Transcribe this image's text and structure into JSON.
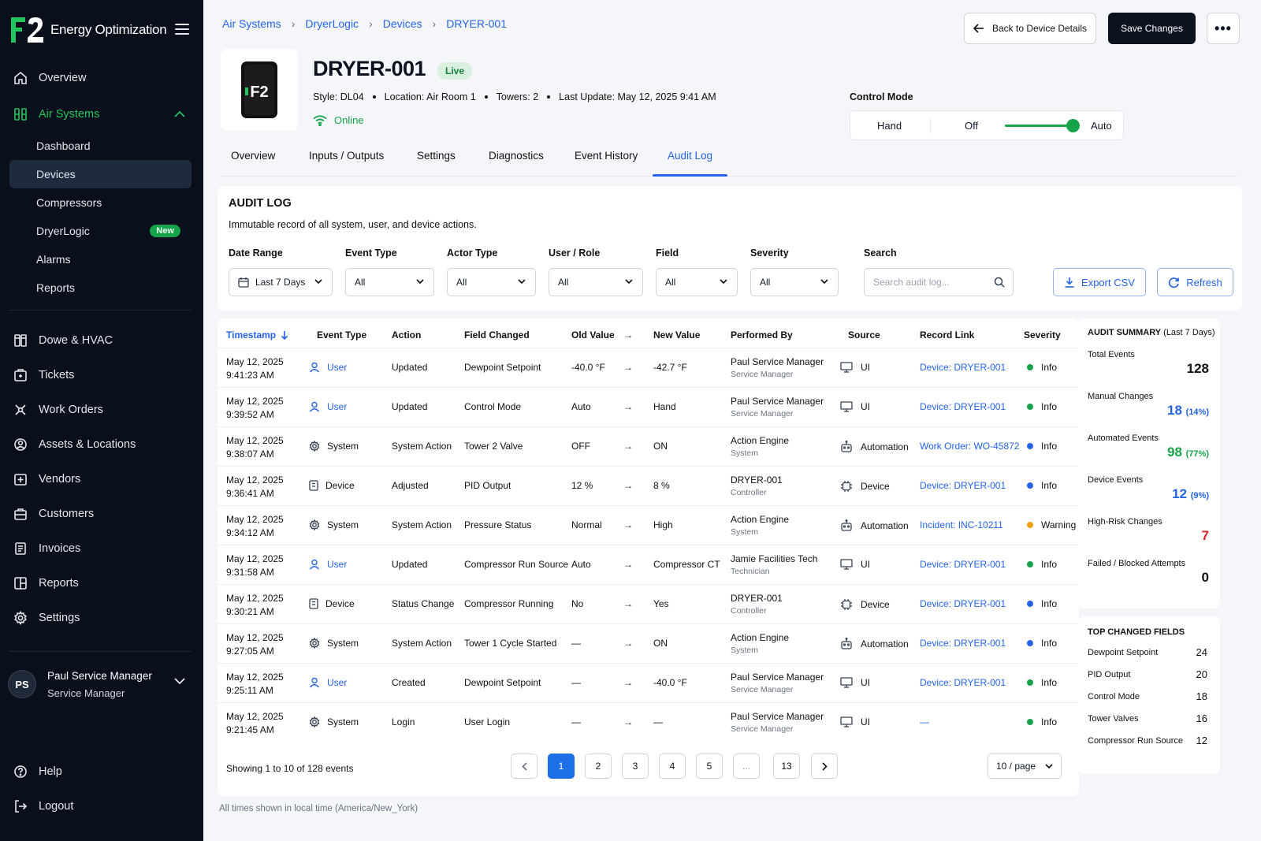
{
  "app": {
    "logo_text": "F2",
    "title": "Energy Optimization"
  },
  "sidebar": {
    "overview": "Overview",
    "air_systems": "Air Systems",
    "sub_items": [
      "Dashboard",
      "Devices",
      "Compressors",
      "DryerLogic",
      "Alarms",
      "Reports"
    ],
    "new_badge": "New",
    "items": [
      "Dowe & HVAC",
      "Tickets",
      "Work Orders",
      "Assets & Locations",
      "Vendors",
      "Customers",
      "Invoices",
      "Reports",
      "Settings"
    ],
    "user": {
      "initials": "PS",
      "name": "Paul Service Manager",
      "role": "Service Manager"
    },
    "help": "Help",
    "logout": "Logout"
  },
  "breadcrumb": [
    "Air Systems",
    "DryerLogic",
    "Devices",
    "DRYER-001"
  ],
  "header": {
    "back_label": "Back to Device Details",
    "save_label": "Save Changes",
    "more_label": "•••"
  },
  "device": {
    "name": "DRYER-001",
    "status_badge": "Live",
    "style": "Style: DL04",
    "location": "Location: Air Room 1",
    "towers": "Towers: 2",
    "last_update": "Last Update: May 12, 2025 9:41 AM",
    "online": "Online",
    "image_text": "F2"
  },
  "control_mode": {
    "label": "Control Mode",
    "hand": "Hand",
    "off": "Off",
    "auto": "Auto",
    "value": 1.0
  },
  "tabs": [
    "Overview",
    "Inputs / Outputs",
    "Settings",
    "Diagnostics",
    "Event History",
    "Audit Log"
  ],
  "audit": {
    "title": "AUDIT LOG",
    "description": "Immutable record of all system, user, and device actions.",
    "filters": {
      "date_range": {
        "label": "Date Range",
        "value": "Last 7 Days"
      },
      "event_type": {
        "label": "Event Type",
        "value": "All"
      },
      "actor_type": {
        "label": "Actor Type",
        "value": "All"
      },
      "user_role": {
        "label": "User / Role",
        "value": "All"
      },
      "field": {
        "label": "Field",
        "value": "All"
      },
      "severity": {
        "label": "Severity",
        "value": "All"
      },
      "search": {
        "label": "Search",
        "placeholder": "Search audit log..."
      }
    },
    "export_label": "Export CSV",
    "refresh_label": "Refresh"
  },
  "table": {
    "columns": [
      "Timestamp",
      "Event Type",
      "Action",
      "Field Changed",
      "Old Value",
      "→",
      "New Value",
      "Performed By",
      "Source",
      "Record Link",
      "Severity"
    ],
    "rows": [
      {
        "date": "May 12, 2025",
        "time": "9:41:23 AM",
        "event_type": "User",
        "action": "Updated",
        "field": "Dewpoint Setpoint",
        "old": "-40.0 °F",
        "arrow": "→",
        "new": "-42.7 °F",
        "by": "Paul Service Manager",
        "by_role": "Service Manager",
        "source": "UI",
        "link": "Device: DRYER-001",
        "severity": "Info",
        "sev_color": "#16a34a"
      },
      {
        "date": "May 12, 2025",
        "time": "9:39:52 AM",
        "event_type": "User",
        "action": "Updated",
        "field": "Control Mode",
        "old": "Auto",
        "arrow": "→",
        "new": "Hand",
        "by": "Paul Service Manager",
        "by_role": "Service Manager",
        "source": "UI",
        "link": "Device: DRYER-001",
        "severity": "Info",
        "sev_color": "#16a34a"
      },
      {
        "date": "May 12, 2025",
        "time": "9:38:07 AM",
        "event_type": "System",
        "action": "System Action",
        "field": "Tower 2 Valve",
        "old": "OFF",
        "arrow": "→",
        "new": "ON",
        "by": "Action Engine",
        "by_role": "System",
        "source": "Automation",
        "link": "Work Order: WO-45872",
        "severity": "Info",
        "sev_color": "#2563eb"
      },
      {
        "date": "May 12, 2025",
        "time": "9:36:41 AM",
        "event_type": "Device",
        "action": "Adjusted",
        "field": "PID Output",
        "old": "12 %",
        "arrow": "→",
        "new": "8 %",
        "by": "DRYER-001",
        "by_role": "Controller",
        "source": "Device",
        "link": "Device: DRYER-001",
        "severity": "Info",
        "sev_color": "#2563eb"
      },
      {
        "date": "May 12, 2025",
        "time": "9:34:12 AM",
        "event_type": "System",
        "action": "System Action",
        "field": "Pressure Status",
        "old": "Normal",
        "arrow": "→",
        "new": "High",
        "by": "Action Engine",
        "by_role": "System",
        "source": "Automation",
        "link": "Incident: INC-10211",
        "severity": "Warning",
        "sev_color": "#f59e0b"
      },
      {
        "date": "May 12, 2025",
        "time": "9:31:58 AM",
        "event_type": "User",
        "action": "Updated",
        "field": "Compressor Run Source",
        "old": "Auto",
        "arrow": "→",
        "new": "Compressor CT",
        "by": "Jamie Facilities Tech",
        "by_role": "Technician",
        "source": "UI",
        "link": "Device: DRYER-001",
        "severity": "Info",
        "sev_color": "#16a34a"
      },
      {
        "date": "May 12, 2025",
        "time": "9:30:21 AM",
        "event_type": "Device",
        "action": "Status Change",
        "field": "Compressor Running",
        "old": "No",
        "arrow": "→",
        "new": "Yes",
        "by": "DRYER-001",
        "by_role": "Controller",
        "source": "Device",
        "link": "Device: DRYER-001",
        "severity": "Info",
        "sev_color": "#2563eb"
      },
      {
        "date": "May 12, 2025",
        "time": "9:27:05 AM",
        "event_type": "System",
        "action": "System Action",
        "field": "Tower 1 Cycle Started",
        "old": "—",
        "arrow": "→",
        "new": "ON",
        "by": "Action Engine",
        "by_role": "System",
        "source": "Automation",
        "link": "Device: DRYER-001",
        "severity": "Info",
        "sev_color": "#2563eb"
      },
      {
        "date": "May 12, 2025",
        "time": "9:25:11 AM",
        "event_type": "User",
        "action": "Created",
        "field": "Dewpoint Setpoint",
        "old": "—",
        "arrow": "→",
        "new": "-40.0 °F",
        "by": "Paul Service Manager",
        "by_role": "Service Manager",
        "source": "UI",
        "link": "Device: DRYER-001",
        "severity": "Info",
        "sev_color": "#16a34a"
      },
      {
        "date": "May 12, 2025",
        "time": "9:21:45 AM",
        "event_type": "System",
        "action": "Login",
        "field": "User Login",
        "old": "—",
        "arrow": "→",
        "new": "—",
        "by": "Paul Service Manager",
        "by_role": "Service Manager",
        "source": "UI",
        "link": "—",
        "severity": "Info",
        "sev_color": "#16a34a"
      }
    ],
    "showing": "Showing 1 to 10 of 128 events",
    "pages": [
      "1",
      "2",
      "3",
      "4",
      "5",
      "...",
      "13"
    ],
    "per_page": "10 / page",
    "footnote": "All times shown in local time (America/New_York)"
  },
  "summary": {
    "title": "AUDIT SUMMARY",
    "period": "(Last 7 Days)",
    "items": [
      {
        "label": "Total Events",
        "value": "128",
        "pct": "",
        "color": "#111111"
      },
      {
        "label": "Manual Changes",
        "value": "18",
        "pct": "(14%)",
        "color": "#2563eb"
      },
      {
        "label": "Automated Events",
        "value": "98",
        "pct": "(77%)",
        "color": "#16a34a"
      },
      {
        "label": "Device Events",
        "value": "12",
        "pct": "(9%)",
        "color": "#2563eb"
      },
      {
        "label": "High-Risk Changes",
        "value": "7",
        "pct": "",
        "color": "#dc2626"
      },
      {
        "label": "Failed / Blocked Attempts",
        "value": "0",
        "pct": "",
        "color": "#111111"
      }
    ]
  },
  "top_fields": {
    "title": "TOP CHANGED FIELDS",
    "items": [
      {
        "name": "Dewpoint Setpoint",
        "count": "24"
      },
      {
        "name": "PID Output",
        "count": "20"
      },
      {
        "name": "Control Mode",
        "count": "18"
      },
      {
        "name": "Tower Valves",
        "count": "16"
      },
      {
        "name": "Compressor Run Source",
        "count": "12"
      }
    ]
  }
}
